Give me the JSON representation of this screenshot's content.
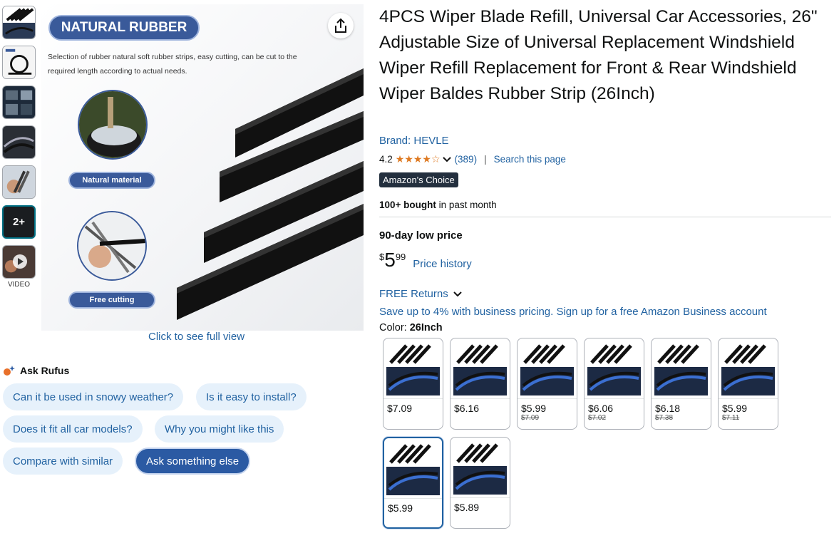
{
  "thumbnails": {
    "more_count": "2+",
    "video_label": "VIDEO"
  },
  "main_image": {
    "banner": "NATURAL RUBBER",
    "description": "Selection of rubber natural soft rubber strips, easy cutting, can be cut to the required length according to actual needs.",
    "label_1": "Natural material",
    "label_2": "Free cutting",
    "full_view": "Click to see full view"
  },
  "rufus": {
    "title": "Ask Rufus",
    "chips": [
      "Can it be used in snowy weather?",
      "Is it easy to install?",
      "Does it fit all car models?",
      "Why you might like this",
      "Compare with similar",
      "Ask something else"
    ]
  },
  "product": {
    "title": "4PCS Wiper Blade Refill, Universal Car Accessories, 26\" Adjustable Size of Universal Replacement Windshield Wiper Refill Replacement for Front & Rear Windshield Wiper Baldes Rubber Strip (26Inch)",
    "brand": "Brand: HEVLE",
    "rating": "4.2",
    "stars": 4.2,
    "reviews": "(389)",
    "search_page": "Search this page",
    "badge": "Amazon's Choice",
    "bought_bold": "100+ bought",
    "bought_rest": " in past month",
    "low_price_label": "90-day low price",
    "price_currency": "$",
    "price_whole": "5",
    "price_cents": "99",
    "price_history": "Price history",
    "returns": "FREE Returns",
    "business": "Save up to 4% with business pricing. Sign up for a free Amazon Business account",
    "color_label": "Color:",
    "color_value": "26Inch"
  },
  "swatches": [
    {
      "price": "$7.09",
      "old": ""
    },
    {
      "price": "$6.16",
      "old": ""
    },
    {
      "price": "$5.99",
      "old": "$7.09"
    },
    {
      "price": "$6.06",
      "old": "$7.02"
    },
    {
      "price": "$6.18",
      "old": "$7.38"
    },
    {
      "price": "$5.99",
      "old": "$7.11"
    },
    {
      "price": "$5.99",
      "old": ""
    },
    {
      "price": "$5.89",
      "old": ""
    }
  ],
  "colors": {
    "link": "#2162a1",
    "star": "#de7921",
    "badge_bg": "#232f3e",
    "banner_blue": "#3a5a9a",
    "chip_bg": "#e6f1fb"
  }
}
